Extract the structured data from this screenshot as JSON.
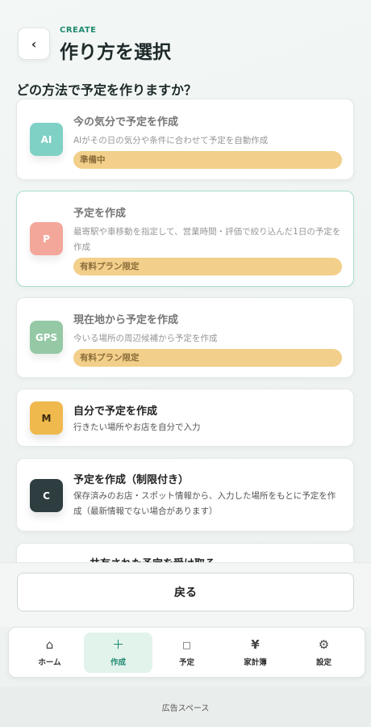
{
  "header": {
    "back_label": "‹",
    "eyebrow": "CREATE",
    "title": "作り方を選択"
  },
  "question": "どの方法で予定を作りますか？",
  "options": [
    {
      "icon_text": "AI",
      "icon_color": "#5cc3b6",
      "title": "今の気分で予定を作成",
      "description": "AIがその日の気分や条件に合わせて予定を自動作成",
      "badge": "準備中"
    },
    {
      "icon_text": "P",
      "icon_color": "#f08f80",
      "title": "予定を作成",
      "description": "最寄駅や車移動を指定して、営業時間・評価で絞り込んだ1日の予定を作成",
      "badge": "有料プラン限定"
    },
    {
      "icon_text": "GPS",
      "icon_color": "#78b98c",
      "title": "現在地から予定を作成",
      "description": "今いる場所の周辺候補から予定を作成",
      "badge": "有料プラン限定"
    },
    {
      "icon_text": "M",
      "icon_color": "#f0b94d",
      "title": "自分で予定を作成",
      "description": "行きたい場所やお店を自分で入力"
    },
    {
      "icon_text": "C",
      "icon_color": "#2e3d40",
      "title": "予定を作成（制限付き）",
      "description": "保存済みのお店・スポット情報から、入力した場所をもとに予定を作成（最新情報でない場合があります）"
    },
    {
      "title": "共有された予定を受け取る"
    }
  ],
  "return_button": "戻る",
  "nav": [
    {
      "icon": "home-icon",
      "glyph": "⌂",
      "label": "ホーム"
    },
    {
      "icon": "plus-icon",
      "glyph": "＋",
      "label": "作成"
    },
    {
      "icon": "calendar-icon",
      "glyph": "□",
      "label": "予定"
    },
    {
      "icon": "yen-icon",
      "glyph": "¥",
      "label": "家計簿"
    },
    {
      "icon": "gear-icon",
      "glyph": "⚙",
      "label": "設定"
    }
  ],
  "ad_space": "広告スペース"
}
